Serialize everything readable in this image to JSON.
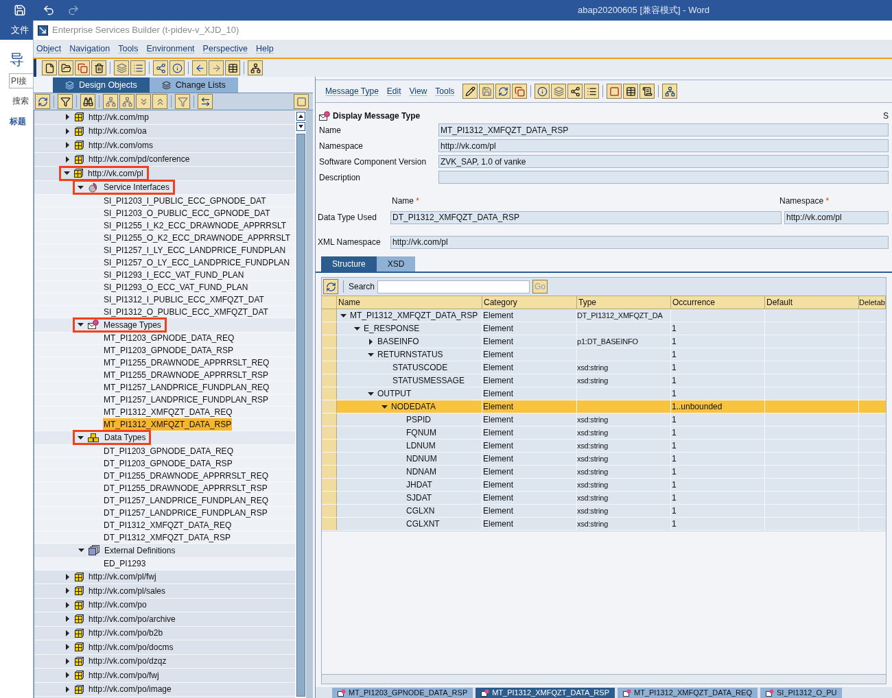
{
  "word": {
    "title": "abap20200605 [兼容模式] - Word",
    "file_tab": "文件",
    "nav_title": "导",
    "search_field": "PI接",
    "search_label": "搜索",
    "headings_tab": "标题"
  },
  "window": {
    "title": "Enterprise Services Builder (t-pidev-v_XJD_10)"
  },
  "menu": [
    "Object",
    "Navigation",
    "Tools",
    "Environment",
    "Perspective",
    "Help"
  ],
  "left_tabs": [
    {
      "label": "Design Objects",
      "selected": true
    },
    {
      "label": "Change Lists",
      "selected": false
    }
  ],
  "tree": [
    {
      "label": "http://vk.com/mp",
      "kind": "namespace",
      "expanded": false,
      "selected": false,
      "highlighted": false
    },
    {
      "label": "http://vk.com/oa",
      "kind": "namespace",
      "expanded": false,
      "selected": false,
      "highlighted": false
    },
    {
      "label": "http://vk.com/oms",
      "kind": "namespace",
      "expanded": false,
      "selected": false,
      "highlighted": false
    },
    {
      "label": "http://vk.com/pd/conference",
      "kind": "namespace",
      "expanded": false,
      "selected": false,
      "highlighted": false
    },
    {
      "label": "http://vk.com/pl",
      "kind": "namespace",
      "expanded": true,
      "selected": false,
      "highlighted": true,
      "children": [
        {
          "label": "Service Interfaces",
          "kind": "service_interfaces",
          "expanded": true,
          "selected": false,
          "highlighted": true,
          "children": [
            {
              "label": "SI_PI1203_I_PUBLIC_ECC_GPNODE_DAT",
              "kind": "object",
              "selected": false,
              "highlighted": false
            },
            {
              "label": "SI_PI1203_O_PUBLIC_ECC_GPNODE_DAT",
              "kind": "object",
              "selected": false,
              "highlighted": false
            },
            {
              "label": "SI_PI1255_I_K2_ECC_DRAWNODE_APPRRSLT",
              "kind": "object",
              "selected": false,
              "highlighted": false
            },
            {
              "label": "SI_PI1255_O_K2_ECC_DRAWNODE_APPRRSLT",
              "kind": "object",
              "selected": false,
              "highlighted": false
            },
            {
              "label": "SI_PI1257_I_LY_ECC_LANDPRICE_FUNDPLAN",
              "kind": "object",
              "selected": false,
              "highlighted": false
            },
            {
              "label": "SI_PI1257_O_LY_ECC_LANDPRICE_FUNDPLAN",
              "kind": "object",
              "selected": false,
              "highlighted": false
            },
            {
              "label": "SI_PI1293_I_ECC_VAT_FUND_PLAN",
              "kind": "object",
              "selected": false,
              "highlighted": false
            },
            {
              "label": "SI_PI1293_O_ECC_VAT_FUND_PLAN",
              "kind": "object",
              "selected": false,
              "highlighted": false
            },
            {
              "label": "SI_PI1312_I_PUBLIC_ECC_XMFQZT_DAT",
              "kind": "object",
              "selected": false,
              "highlighted": false
            },
            {
              "label": "SI_PI1312_O_PUBLIC_ECC_XMFQZT_DAT",
              "kind": "object",
              "selected": false,
              "highlighted": false
            }
          ]
        },
        {
          "label": "Message Types",
          "kind": "message_types",
          "expanded": true,
          "selected": false,
          "highlighted": true,
          "children": [
            {
              "label": "MT_PI1203_GPNODE_DATA_REQ",
              "kind": "object",
              "selected": false,
              "highlighted": false
            },
            {
              "label": "MT_PI1203_GPNODE_DATA_RSP",
              "kind": "object",
              "selected": false,
              "highlighted": false
            },
            {
              "label": "MT_PI1255_DRAWNODE_APPRRSLT_REQ",
              "kind": "object",
              "selected": false,
              "highlighted": false
            },
            {
              "label": "MT_PI1255_DRAWNODE_APPRRSLT_RSP",
              "kind": "object",
              "selected": false,
              "highlighted": false
            },
            {
              "label": "MT_PI1257_LANDPRICE_FUNDPLAN_REQ",
              "kind": "object",
              "selected": false,
              "highlighted": false
            },
            {
              "label": "MT_PI1257_LANDPRICE_FUNDPLAN_RSP",
              "kind": "object",
              "selected": false,
              "highlighted": false
            },
            {
              "label": "MT_PI1312_XMFQZT_DATA_REQ",
              "kind": "object",
              "selected": false,
              "highlighted": false
            },
            {
              "label": "MT_PI1312_XMFQZT_DATA_RSP",
              "kind": "object",
              "selected": true,
              "highlighted": false
            }
          ]
        },
        {
          "label": "Data Types",
          "kind": "data_types",
          "expanded": true,
          "selected": false,
          "highlighted": true,
          "children": [
            {
              "label": "DT_PI1203_GPNODE_DATA_REQ",
              "kind": "object",
              "selected": false,
              "highlighted": false
            },
            {
              "label": "DT_PI1203_GPNODE_DATA_RSP",
              "kind": "object",
              "selected": false,
              "highlighted": false
            },
            {
              "label": "DT_PI1255_DRAWNODE_APPRRSLT_REQ",
              "kind": "object",
              "selected": false,
              "highlighted": false
            },
            {
              "label": "DT_PI1255_DRAWNODE_APPRRSLT_RSP",
              "kind": "object",
              "selected": false,
              "highlighted": false
            },
            {
              "label": "DT_PI1257_LANDPRICE_FUNDPLAN_REQ",
              "kind": "object",
              "selected": false,
              "highlighted": false
            },
            {
              "label": "DT_PI1257_LANDPRICE_FUNDPLAN_RSP",
              "kind": "object",
              "selected": false,
              "highlighted": false
            },
            {
              "label": "DT_PI1312_XMFQZT_DATA_REQ",
              "kind": "object",
              "selected": false,
              "highlighted": false
            },
            {
              "label": "DT_PI1312_XMFQZT_DATA_RSP",
              "kind": "object",
              "selected": false,
              "highlighted": false
            }
          ]
        },
        {
          "label": "External Definitions",
          "kind": "external_definitions",
          "expanded": true,
          "selected": false,
          "highlighted": false,
          "children": [
            {
              "label": "ED_PI1293",
              "kind": "object",
              "selected": false,
              "highlighted": false
            }
          ]
        }
      ]
    },
    {
      "label": "http://vk.com/pl/fwj",
      "kind": "namespace",
      "expanded": false,
      "selected": false,
      "highlighted": false
    },
    {
      "label": "http://vk.com/pl/sales",
      "kind": "namespace",
      "expanded": false,
      "selected": false,
      "highlighted": false
    },
    {
      "label": "http://vk.com/po",
      "kind": "namespace",
      "expanded": false,
      "selected": false,
      "highlighted": false
    },
    {
      "label": "http://vk.com/po/archive",
      "kind": "namespace",
      "expanded": false,
      "selected": false,
      "highlighted": false
    },
    {
      "label": "http://vk.com/po/b2b",
      "kind": "namespace",
      "expanded": false,
      "selected": false,
      "highlighted": false
    },
    {
      "label": "http://vk.com/po/docms",
      "kind": "namespace",
      "expanded": false,
      "selected": false,
      "highlighted": false
    },
    {
      "label": "http://vk.com/po/dzqz",
      "kind": "namespace",
      "expanded": false,
      "selected": false,
      "highlighted": false
    },
    {
      "label": "http://vk.com/po/fwj",
      "kind": "namespace",
      "expanded": false,
      "selected": false,
      "highlighted": false
    },
    {
      "label": "http://vk.com/po/image",
      "kind": "namespace",
      "expanded": false,
      "selected": false,
      "highlighted": false
    }
  ],
  "editor": {
    "menu": [
      "Message Type",
      "Edit",
      "View",
      "Tools"
    ],
    "heading": "Display Message Type",
    "corner_text": "S",
    "fields": [
      {
        "label": "Name",
        "value": "MT_PI1312_XMFQZT_DATA_RSP"
      },
      {
        "label": "Namespace",
        "value": "http://vk.com/pl"
      },
      {
        "label": "Software Component Version",
        "value": "ZVK_SAP, 1.0 of vanke"
      },
      {
        "label": "Description"
      }
    ],
    "data_type": {
      "row_label": "Data Type Used",
      "name_label": "Name",
      "name_value": "DT_PI1312_XMFQZT_DATA_RSP",
      "namespace_label": "Namespace",
      "namespace_value": "http://vk.com/pl",
      "required_mark": "*"
    },
    "xml_namespace": {
      "label": "XML Namespace",
      "value": "http://vk.com/pl"
    },
    "tabs": [
      {
        "label": "Structure",
        "selected": true
      },
      {
        "label": "XSD",
        "selected": false
      }
    ],
    "search": {
      "label": "Search",
      "button": "Go"
    },
    "columns": [
      "Name",
      "Category",
      "Type",
      "Occurrence",
      "Default",
      "Deletab"
    ],
    "rows": [
      {
        "name": "MT_PI1312_XMFQZT_DATA_RSP",
        "category": "Element",
        "type": "DT_PI1312_XMFQZT_DA",
        "expanded": true,
        "selected": false,
        "children": [
          {
            "name": "E_RESPONSE",
            "category": "Element",
            "occurrence": "1",
            "expanded": true,
            "selected": false,
            "children": [
              {
                "name": "BASEINFO",
                "category": "Element",
                "type": "p1:DT_BASEINFO",
                "occurrence": "1",
                "expanded": false,
                "selected": false
              },
              {
                "name": "RETURNSTATUS",
                "category": "Element",
                "occurrence": "1",
                "expanded": true,
                "selected": false,
                "children": [
                  {
                    "name": "STATUSCODE",
                    "category": "Element",
                    "type": "xsd:string",
                    "occurrence": "1",
                    "selected": false
                  },
                  {
                    "name": "STATUSMESSAGE",
                    "category": "Element",
                    "type": "xsd:string",
                    "occurrence": "1",
                    "selected": false
                  }
                ]
              },
              {
                "name": "OUTPUT",
                "category": "Element",
                "occurrence": "1",
                "expanded": true,
                "selected": false,
                "children": [
                  {
                    "name": "NODEDATA",
                    "category": "Element",
                    "occurrence": "1..unbounded",
                    "expanded": true,
                    "selected": true,
                    "children": [
                      {
                        "name": "PSPID",
                        "category": "Element",
                        "type": "xsd:string",
                        "occurrence": "1",
                        "selected": false
                      },
                      {
                        "name": "FQNUM",
                        "category": "Element",
                        "type": "xsd:string",
                        "occurrence": "1",
                        "selected": false
                      },
                      {
                        "name": "LDNUM",
                        "category": "Element",
                        "type": "xsd:string",
                        "occurrence": "1",
                        "selected": false
                      },
                      {
                        "name": "NDNUM",
                        "category": "Element",
                        "type": "xsd:string",
                        "occurrence": "1",
                        "selected": false
                      },
                      {
                        "name": "NDNAM",
                        "category": "Element",
                        "type": "xsd:string",
                        "occurrence": "1",
                        "selected": false
                      },
                      {
                        "name": "JHDAT",
                        "category": "Element",
                        "type": "xsd:string",
                        "occurrence": "1",
                        "selected": false
                      },
                      {
                        "name": "SJDAT",
                        "category": "Element",
                        "type": "xsd:string",
                        "occurrence": "1",
                        "selected": false
                      },
                      {
                        "name": "CGLXN",
                        "category": "Element",
                        "type": "xsd:string",
                        "occurrence": "1",
                        "selected": false
                      },
                      {
                        "name": "CGLXNT",
                        "category": "Element",
                        "type": "xsd:string",
                        "occurrence": "1",
                        "selected": false
                      }
                    ]
                  }
                ]
              }
            ]
          }
        ]
      }
    ],
    "bottom_tabs": [
      {
        "label": "MT_PI1203_GPNODE_DATA_RSP",
        "selected": false
      },
      {
        "label": "MT_PI1312_XMFQZT_DATA_RSP",
        "selected": true
      },
      {
        "label": "MT_PI1312_XMFQZT_DATA_REQ",
        "selected": false
      },
      {
        "label": "SI_PI1312_O_PU",
        "selected": false
      }
    ]
  }
}
